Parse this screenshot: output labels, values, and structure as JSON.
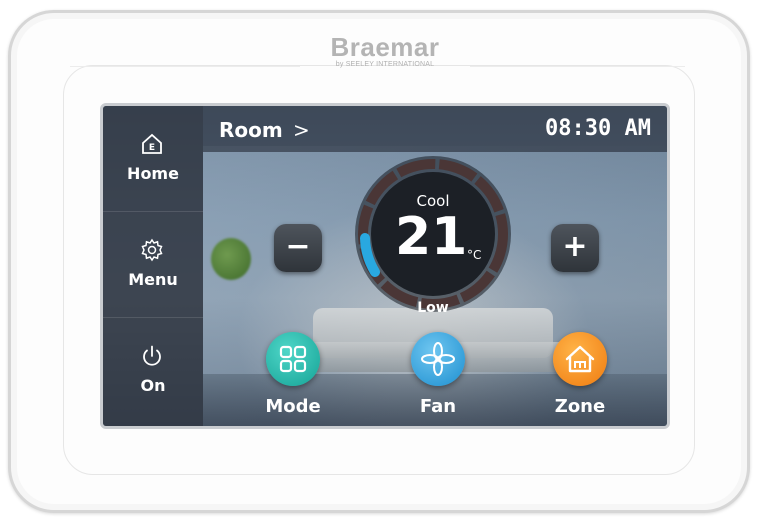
{
  "brand": {
    "name": "Braemar",
    "subtitle": "by SEELEY INTERNATIONAL"
  },
  "header": {
    "room_label": "Room",
    "room_chevron": ">",
    "time": "08:30 AM"
  },
  "sidebar": {
    "items": [
      {
        "label": "Home",
        "icon": "home-icon"
      },
      {
        "label": "Menu",
        "icon": "gear-icon"
      },
      {
        "label": "On",
        "icon": "power-icon"
      }
    ]
  },
  "thermostat": {
    "mode": "Cool",
    "temperature": "21",
    "unit": "°C",
    "fan_speed": "Low",
    "decrease_label": "−",
    "increase_label": "+"
  },
  "bottom_buttons": [
    {
      "label": "Mode",
      "icon": "grid-icon",
      "color": "#1fb7ab"
    },
    {
      "label": "Fan",
      "icon": "fan-icon",
      "color": "#2aa2dc"
    },
    {
      "label": "Zone",
      "icon": "house-icon",
      "color": "#f28a1d"
    }
  ],
  "colors": {
    "dial_accent": "#29a8e0",
    "dial_ring": "#3a2a2a"
  }
}
